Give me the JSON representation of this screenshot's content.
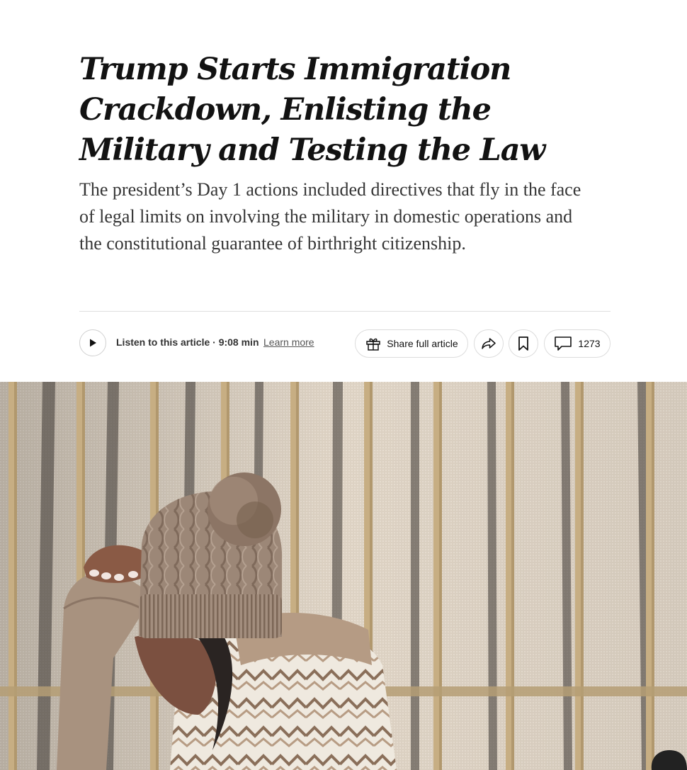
{
  "article": {
    "headline": "Trump Starts Immigration Crackdown, Enlisting the Military and Testing the Law",
    "summary": "The president’s Day 1 actions included directives that fly in the face of legal limits on involving the military in domestic operations and the constitutional guarantee of birthright citizenship."
  },
  "toolbar": {
    "listen_label": "Listen to this article · 9:08 min",
    "learn_more_label": "Learn more",
    "share_label": "Share full article",
    "comment_count": "1273"
  },
  "icons": {
    "play": "play-icon",
    "gift": "gift-icon",
    "forward": "share-arrow-icon",
    "bookmark": "bookmark-icon",
    "comment": "comment-bubble-icon"
  },
  "colors": {
    "text": "#121212",
    "summary": "#363636",
    "border": "#dcdcdc"
  }
}
